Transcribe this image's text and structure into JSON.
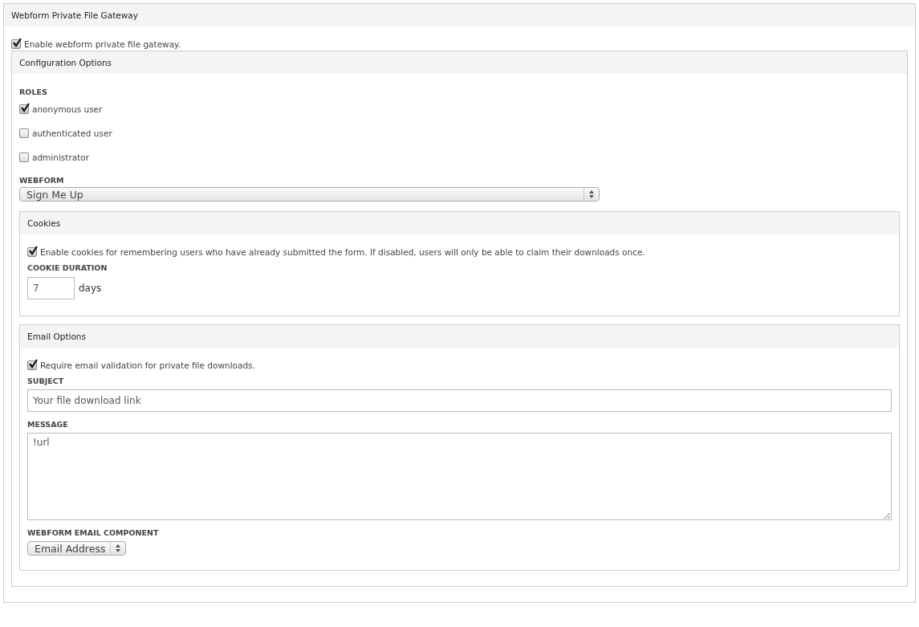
{
  "panel": {
    "title": "Webform Private File Gateway",
    "enable": {
      "label": "Enable webform private file gateway.",
      "checked": true
    }
  },
  "config": {
    "title": "Configuration Options",
    "roles_label": "ROLES",
    "roles": [
      {
        "label": "anonymous user",
        "checked": true
      },
      {
        "label": "authenticated user",
        "checked": false
      },
      {
        "label": "administrator",
        "checked": false
      }
    ],
    "webform_label": "WEBFORM",
    "webform_value": "Sign Me Up"
  },
  "cookies": {
    "title": "Cookies",
    "enable": {
      "label": "Enable cookies for remembering users who have already submitted the form. If disabled, users will only be able to claim their downloads once.",
      "checked": true
    },
    "duration_label": "COOKIE DURATION",
    "duration_value": "7",
    "duration_unit": "days"
  },
  "email": {
    "title": "Email Options",
    "require": {
      "label": "Require email validation for private file downloads.",
      "checked": true
    },
    "subject_label": "SUBJECT",
    "subject_value": "Your file download link",
    "message_label": "MESSAGE",
    "message_value": "!url",
    "component_label": "WEBFORM EMAIL COMPONENT",
    "component_value": "Email Address"
  }
}
